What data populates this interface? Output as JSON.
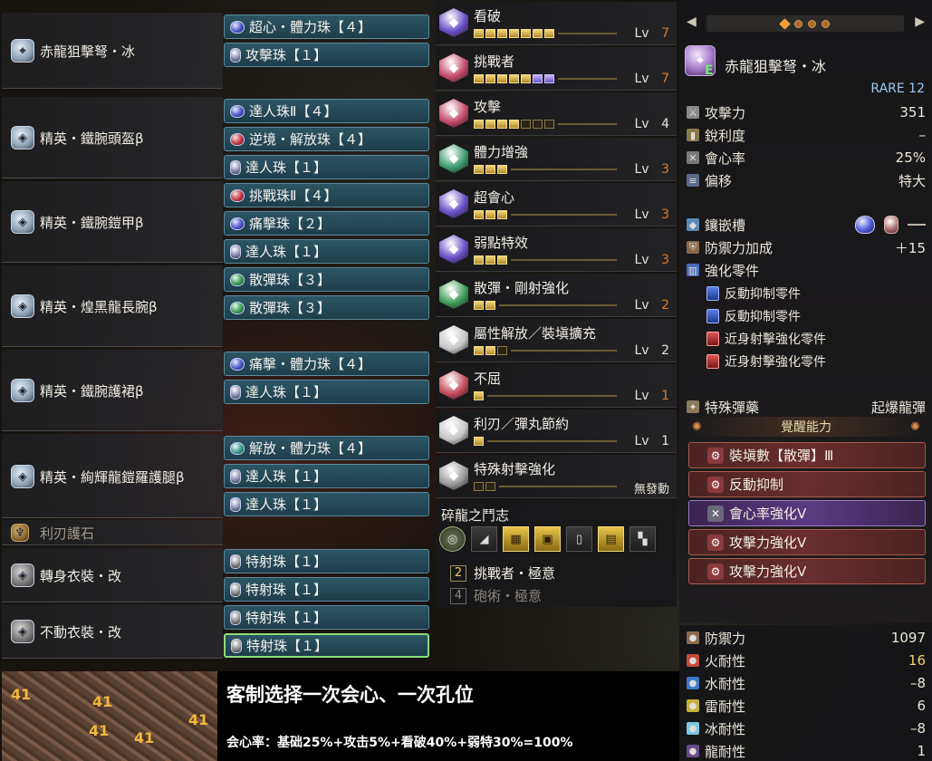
{
  "equipment": [
    {
      "name": "赤龍狙擊弩・冰",
      "decos": [
        {
          "label": "超心・體力珠【４】",
          "gem": "blue"
        },
        {
          "label": "攻擊珠【１】",
          "gem": "slot"
        }
      ]
    },
    {
      "name": "精英・鐵腕頭盔β",
      "decos": [
        {
          "label": "達人珠Ⅱ【４】",
          "gem": "blue"
        },
        {
          "label": "逆境・解放珠【４】",
          "gem": "red"
        },
        {
          "label": "達人珠【１】",
          "gem": "slot"
        }
      ]
    },
    {
      "name": "精英・鐵腕鎧甲β",
      "decos": [
        {
          "label": "挑戰珠Ⅱ【４】",
          "gem": "red"
        },
        {
          "label": "痛擊珠【２】",
          "gem": "blue"
        },
        {
          "label": "達人珠【１】",
          "gem": "slot"
        }
      ]
    },
    {
      "name": "精英・煌黑龍長腕β",
      "decos": [
        {
          "label": "散彈珠【３】",
          "gem": "green"
        },
        {
          "label": "散彈珠【３】",
          "gem": "green"
        }
      ]
    },
    {
      "name": "精英・鐵腕護裙β",
      "decos": [
        {
          "label": "痛擊・體力珠【４】",
          "gem": "blue"
        },
        {
          "label": "達人珠【１】",
          "gem": "slot"
        }
      ]
    },
    {
      "name": "精英・絢輝龍鎧羅護腿β",
      "decos": [
        {
          "label": "解放・體力珠【４】",
          "gem": "teal"
        },
        {
          "label": "達人珠【１】",
          "gem": "slot"
        },
        {
          "label": "達人珠【１】",
          "gem": "slot"
        }
      ]
    },
    {
      "name": "利刃護石",
      "decos": []
    },
    {
      "name": "轉身衣裝・改",
      "decos": [
        {
          "label": "特射珠【１】",
          "gem": "grey"
        },
        {
          "label": "特射珠【１】",
          "gem": "grey"
        }
      ]
    },
    {
      "name": "不動衣裝・改",
      "decos": [
        {
          "label": "特射珠【１】",
          "gem": "grey"
        },
        {
          "label": "特射珠【１】",
          "gem": "grey"
        }
      ]
    }
  ],
  "skills": [
    {
      "name": "看破",
      "level": "7",
      "on": 7,
      "max": 7,
      "purple": 0,
      "lv_color": "orange",
      "color": "#6a4fc7"
    },
    {
      "name": "挑戰者",
      "level": "7",
      "on": 5,
      "max": 7,
      "purple": 2,
      "lv_color": "orange",
      "color": "#c44a6a"
    },
    {
      "name": "攻擊",
      "level": "4",
      "on": 4,
      "max": 7,
      "purple": 0,
      "lv_color": "white",
      "color": "#c44a6a"
    },
    {
      "name": "體力增強",
      "level": "3",
      "on": 3,
      "max": 3,
      "purple": 0,
      "lv_color": "orange",
      "color": "#3f9c70"
    },
    {
      "name": "超會心",
      "level": "3",
      "on": 3,
      "max": 3,
      "purple": 0,
      "lv_color": "orange",
      "color": "#6a4fc7"
    },
    {
      "name": "弱點特效",
      "level": "3",
      "on": 3,
      "max": 3,
      "purple": 0,
      "lv_color": "orange",
      "color": "#6a4fc7"
    },
    {
      "name": "散彈・剛射強化",
      "level": "2",
      "on": 2,
      "max": 2,
      "purple": 0,
      "lv_color": "orange",
      "color": "#3f9c5a"
    },
    {
      "name": "屬性解放／裝塡擴充",
      "level": "2",
      "on": 2,
      "max": 3,
      "purple": 0,
      "lv_color": "white",
      "color": "#c8c8c8"
    },
    {
      "name": "不屈",
      "level": "1",
      "on": 1,
      "max": 1,
      "purple": 0,
      "lv_color": "orange",
      "color": "#c44a5a"
    },
    {
      "name": "利刃／彈丸節約",
      "level": "1",
      "on": 1,
      "max": 1,
      "purple": 0,
      "lv_color": "white",
      "color": "#c8c8c8"
    },
    {
      "name": "特殊射擊強化",
      "level": "無發動",
      "on": 0,
      "max": 2,
      "purple": 0,
      "lv_color": "white",
      "color": "#9a9a9a"
    }
  ],
  "set_bonus": {
    "title": "碎龍之鬥志",
    "skills": [
      {
        "count": "2",
        "name": "挑戰者・極意",
        "active": true
      },
      {
        "count": "4",
        "name": "砲術・極意",
        "active": false
      }
    ]
  },
  "weapon": {
    "name": "赤龍狙擊弩・冰",
    "rare": "RARE 12",
    "badge": "E",
    "stats": [
      {
        "label": "攻擊力",
        "value": "351"
      },
      {
        "label": "銳利度",
        "value": "–"
      },
      {
        "label": "會心率",
        "value": "25%"
      },
      {
        "label": "偏移",
        "value": "特大"
      }
    ],
    "slots_label": "鑲嵌槽",
    "slot_empty": "—",
    "defense_bonus_label": "防禦力加成",
    "defense_bonus_value": "＋15",
    "parts_label": "強化零件",
    "parts": [
      {
        "label": "反動抑制零件",
        "color": "blue"
      },
      {
        "label": "反動抑制零件",
        "color": "blue"
      },
      {
        "label": "近身射擊強化零件",
        "color": "red"
      },
      {
        "label": "近身射擊強化零件",
        "color": "red"
      }
    ],
    "special_ammo_label": "特殊彈藥",
    "special_ammo_value": "起爆龍彈",
    "awaken_header": "覺醒能力",
    "awakenings": [
      {
        "label": "裝塡數【散彈】Ⅲ",
        "style": "red"
      },
      {
        "label": "反動抑制",
        "style": "red"
      },
      {
        "label": "會心率強化Ⅴ",
        "style": "purple"
      },
      {
        "label": "攻擊力強化Ⅴ",
        "style": "red"
      },
      {
        "label": "攻擊力強化Ⅴ",
        "style": "red"
      }
    ]
  },
  "defense": [
    {
      "label": "防禦力",
      "value": "1097",
      "highlight": false
    },
    {
      "label": "火耐性",
      "value": "16",
      "highlight": true
    },
    {
      "label": "水耐性",
      "value": "–8",
      "highlight": false
    },
    {
      "label": "雷耐性",
      "value": "6",
      "highlight": false
    },
    {
      "label": "冰耐性",
      "value": "–8",
      "highlight": false
    },
    {
      "label": "龍耐性",
      "value": "1",
      "highlight": false
    }
  ],
  "overlay": {
    "map_numbers": [
      "41",
      "41",
      "41",
      "41",
      "41"
    ],
    "caption_main": "客制选择一次会心、一次孔位",
    "caption_sub": "会心率：基础25%+攻击5%+看破40%+弱特30%=100%"
  }
}
